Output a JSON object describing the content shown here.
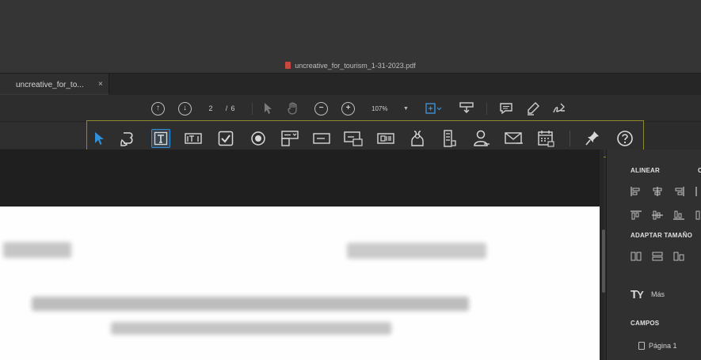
{
  "window": {
    "title": "uncreative_for_tourism_1-31-2023.pdf"
  },
  "tab": {
    "label": "uncreative_for_to...",
    "close": "×"
  },
  "toolbar": {
    "page_current": "2",
    "page_sep": "/",
    "page_total": "6",
    "zoom": "107%",
    "icons": [
      "page-up-icon",
      "page-down-icon",
      "select-cursor-icon",
      "hand-pan-icon",
      "zoom-out-icon",
      "zoom-in-icon",
      "fit-page-icon",
      "stamp-icon",
      "comment-icon",
      "highlight-pen-icon",
      "sign-icon"
    ]
  },
  "form_toolbar": {
    "tools": [
      "select-arrow",
      "edit-fields",
      "text-field",
      "text-box",
      "checkbox",
      "radio-button",
      "list-box",
      "dropdown",
      "button",
      "image-field",
      "barcode",
      "signature",
      "mail",
      "date",
      "pin",
      "help"
    ],
    "accent_color": "#2f8fd8",
    "border_color": "#8d8a2e"
  },
  "right_panel": {
    "align_heading": "ALINEAR",
    "fit_size_heading": "ADAPTAR TAMAÑO",
    "more_label": "Más",
    "fields_heading": "CAMPOS",
    "page_item": "Página 1"
  }
}
